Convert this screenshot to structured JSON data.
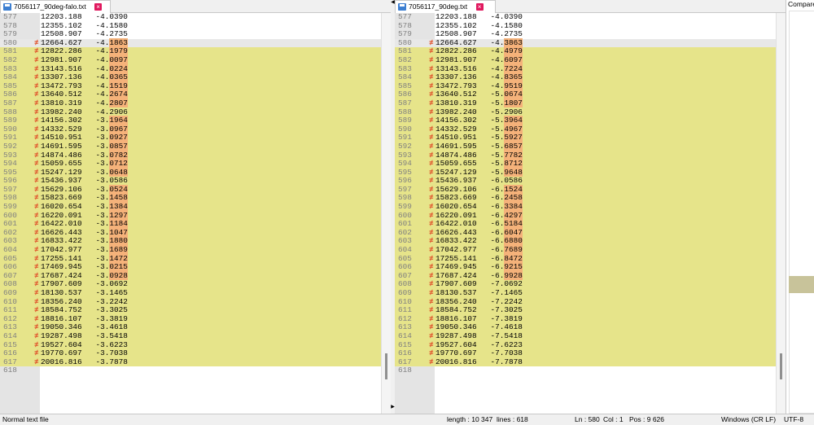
{
  "left": {
    "tab": "7056117_90deg-falo.txt",
    "rows": [
      {
        "n": "577",
        "x": "12203.188",
        "y": "-4.0390",
        "c": false,
        "h": ""
      },
      {
        "n": "578",
        "x": "12355.102",
        "y": "-4.1580",
        "c": false,
        "h": ""
      },
      {
        "n": "579",
        "x": "12508.907",
        "y": "-4.2735",
        "c": false,
        "h": ""
      },
      {
        "n": "580",
        "x": "12664.627",
        "y": "-4.1863",
        "c": true,
        "h": "1863"
      },
      {
        "n": "581",
        "x": "12822.286",
        "y": "-4.1979",
        "c": true,
        "h": "1979"
      },
      {
        "n": "582",
        "x": "12981.907",
        "y": "-4.0097",
        "c": true,
        "h": "0097"
      },
      {
        "n": "583",
        "x": "13143.516",
        "y": "-4.0224",
        "c": true,
        "h": "0224"
      },
      {
        "n": "584",
        "x": "13307.136",
        "y": "-4.0365",
        "c": true,
        "h": "0365"
      },
      {
        "n": "585",
        "x": "13472.793",
        "y": "-4.1519",
        "c": true,
        "h": "1519"
      },
      {
        "n": "586",
        "x": "13640.512",
        "y": "-4.2674",
        "c": true,
        "h": "2674"
      },
      {
        "n": "587",
        "x": "13810.319",
        "y": "-4.2807",
        "c": true,
        "h": "2807"
      },
      {
        "n": "588",
        "x": "13982.240",
        "y": "-4.2906",
        "c": true,
        "h": ""
      },
      {
        "n": "589",
        "x": "14156.302",
        "y": "-3.1964",
        "c": true,
        "h": "1964"
      },
      {
        "n": "590",
        "x": "14332.529",
        "y": "-3.0967",
        "c": true,
        "h": "0967"
      },
      {
        "n": "591",
        "x": "14510.951",
        "y": "-3.0927",
        "c": true,
        "h": "0927"
      },
      {
        "n": "592",
        "x": "14691.595",
        "y": "-3.0857",
        "c": true,
        "h": "0857"
      },
      {
        "n": "593",
        "x": "14874.486",
        "y": "-3.0782",
        "c": true,
        "h": "0782"
      },
      {
        "n": "594",
        "x": "15059.655",
        "y": "-3.0712",
        "c": true,
        "h": "0712"
      },
      {
        "n": "595",
        "x": "15247.129",
        "y": "-3.0648",
        "c": true,
        "h": "0648"
      },
      {
        "n": "596",
        "x": "15436.937",
        "y": "-3.0586",
        "c": true,
        "h": ""
      },
      {
        "n": "597",
        "x": "15629.106",
        "y": "-3.0524",
        "c": true,
        "h": "0524"
      },
      {
        "n": "598",
        "x": "15823.669",
        "y": "-3.1458",
        "c": true,
        "h": "1458"
      },
      {
        "n": "599",
        "x": "16020.654",
        "y": "-3.1384",
        "c": true,
        "h": "1384"
      },
      {
        "n": "600",
        "x": "16220.091",
        "y": "-3.1297",
        "c": true,
        "h": "1297"
      },
      {
        "n": "601",
        "x": "16422.010",
        "y": "-3.1184",
        "c": true,
        "h": "1184"
      },
      {
        "n": "602",
        "x": "16626.443",
        "y": "-3.1047",
        "c": true,
        "h": "1047"
      },
      {
        "n": "603",
        "x": "16833.422",
        "y": "-3.1880",
        "c": true,
        "h": "1880"
      },
      {
        "n": "604",
        "x": "17042.977",
        "y": "-3.1689",
        "c": true,
        "h": "1689"
      },
      {
        "n": "605",
        "x": "17255.141",
        "y": "-3.1472",
        "c": true,
        "h": "1472"
      },
      {
        "n": "606",
        "x": "17469.945",
        "y": "-3.0215",
        "c": true,
        "h": "0215"
      },
      {
        "n": "607",
        "x": "17687.424",
        "y": "-3.0928",
        "c": true,
        "h": "0928"
      },
      {
        "n": "608",
        "x": "17907.609",
        "y": "-3.0692",
        "c": true,
        "h": ""
      },
      {
        "n": "609",
        "x": "18130.537",
        "y": "-3.1465",
        "c": true,
        "h": ""
      },
      {
        "n": "610",
        "x": "18356.240",
        "y": "-3.2242",
        "c": true,
        "h": ""
      },
      {
        "n": "611",
        "x": "18584.752",
        "y": "-3.3025",
        "c": true,
        "h": ""
      },
      {
        "n": "612",
        "x": "18816.107",
        "y": "-3.3819",
        "c": true,
        "h": ""
      },
      {
        "n": "613",
        "x": "19050.346",
        "y": "-3.4618",
        "c": true,
        "h": ""
      },
      {
        "n": "614",
        "x": "19287.498",
        "y": "-3.5418",
        "c": true,
        "h": ""
      },
      {
        "n": "615",
        "x": "19527.604",
        "y": "-3.6223",
        "c": true,
        "h": ""
      },
      {
        "n": "616",
        "x": "19770.697",
        "y": "-3.7038",
        "c": true,
        "h": ""
      },
      {
        "n": "617",
        "x": "20016.816",
        "y": "-3.7878",
        "c": true,
        "h": ""
      },
      {
        "n": "618",
        "x": "",
        "y": "",
        "c": false,
        "h": ""
      }
    ]
  },
  "right": {
    "tab": "7056117_90deg.txt",
    "rows": [
      {
        "n": "577",
        "x": "12203.188",
        "y": "-4.0390",
        "c": false,
        "h": ""
      },
      {
        "n": "578",
        "x": "12355.102",
        "y": "-4.1580",
        "c": false,
        "h": ""
      },
      {
        "n": "579",
        "x": "12508.907",
        "y": "-4.2735",
        "c": false,
        "h": ""
      },
      {
        "n": "580",
        "x": "12664.627",
        "y": "-4.3863",
        "c": true,
        "h": "3863"
      },
      {
        "n": "581",
        "x": "12822.286",
        "y": "-4.4979",
        "c": true,
        "h": "4979"
      },
      {
        "n": "582",
        "x": "12981.907",
        "y": "-4.6097",
        "c": true,
        "h": "6097"
      },
      {
        "n": "583",
        "x": "13143.516",
        "y": "-4.7224",
        "c": true,
        "h": "7224"
      },
      {
        "n": "584",
        "x": "13307.136",
        "y": "-4.8365",
        "c": true,
        "h": "8365"
      },
      {
        "n": "585",
        "x": "13472.793",
        "y": "-4.9519",
        "c": true,
        "h": "9519"
      },
      {
        "n": "586",
        "x": "13640.512",
        "y": "-5.0674",
        "c": true,
        "h": "0674"
      },
      {
        "n": "587",
        "x": "13810.319",
        "y": "-5.1807",
        "c": true,
        "h": "1807"
      },
      {
        "n": "588",
        "x": "13982.240",
        "y": "-5.2906",
        "c": true,
        "h": ""
      },
      {
        "n": "589",
        "x": "14156.302",
        "y": "-5.3964",
        "c": true,
        "h": "3964"
      },
      {
        "n": "590",
        "x": "14332.529",
        "y": "-5.4967",
        "c": true,
        "h": "4967"
      },
      {
        "n": "591",
        "x": "14510.951",
        "y": "-5.5927",
        "c": true,
        "h": "5927"
      },
      {
        "n": "592",
        "x": "14691.595",
        "y": "-5.6857",
        "c": true,
        "h": "6857"
      },
      {
        "n": "593",
        "x": "14874.486",
        "y": "-5.7782",
        "c": true,
        "h": "7782"
      },
      {
        "n": "594",
        "x": "15059.655",
        "y": "-5.8712",
        "c": true,
        "h": "8712"
      },
      {
        "n": "595",
        "x": "15247.129",
        "y": "-5.9648",
        "c": true,
        "h": "9648"
      },
      {
        "n": "596",
        "x": "15436.937",
        "y": "-6.0586",
        "c": true,
        "h": ""
      },
      {
        "n": "597",
        "x": "15629.106",
        "y": "-6.1524",
        "c": true,
        "h": "1524"
      },
      {
        "n": "598",
        "x": "15823.669",
        "y": "-6.2458",
        "c": true,
        "h": "2458"
      },
      {
        "n": "599",
        "x": "16020.654",
        "y": "-6.3384",
        "c": true,
        "h": "3384"
      },
      {
        "n": "600",
        "x": "16220.091",
        "y": "-6.4297",
        "c": true,
        "h": "4297"
      },
      {
        "n": "601",
        "x": "16422.010",
        "y": "-6.5184",
        "c": true,
        "h": "5184"
      },
      {
        "n": "602",
        "x": "16626.443",
        "y": "-6.6047",
        "c": true,
        "h": "6047"
      },
      {
        "n": "603",
        "x": "16833.422",
        "y": "-6.6880",
        "c": true,
        "h": "6880"
      },
      {
        "n": "604",
        "x": "17042.977",
        "y": "-6.7689",
        "c": true,
        "h": "7689"
      },
      {
        "n": "605",
        "x": "17255.141",
        "y": "-6.8472",
        "c": true,
        "h": "8472"
      },
      {
        "n": "606",
        "x": "17469.945",
        "y": "-6.9215",
        "c": true,
        "h": "9215"
      },
      {
        "n": "607",
        "x": "17687.424",
        "y": "-6.9928",
        "c": true,
        "h": "9928"
      },
      {
        "n": "608",
        "x": "17907.609",
        "y": "-7.0692",
        "c": true,
        "h": ""
      },
      {
        "n": "609",
        "x": "18130.537",
        "y": "-7.1465",
        "c": true,
        "h": ""
      },
      {
        "n": "610",
        "x": "18356.240",
        "y": "-7.2242",
        "c": true,
        "h": ""
      },
      {
        "n": "611",
        "x": "18584.752",
        "y": "-7.3025",
        "c": true,
        "h": ""
      },
      {
        "n": "612",
        "x": "18816.107",
        "y": "-7.3819",
        "c": true,
        "h": ""
      },
      {
        "n": "613",
        "x": "19050.346",
        "y": "-7.4618",
        "c": true,
        "h": ""
      },
      {
        "n": "614",
        "x": "19287.498",
        "y": "-7.5418",
        "c": true,
        "h": ""
      },
      {
        "n": "615",
        "x": "19527.604",
        "y": "-7.6223",
        "c": true,
        "h": ""
      },
      {
        "n": "616",
        "x": "19770.697",
        "y": "-7.7038",
        "c": true,
        "h": ""
      },
      {
        "n": "617",
        "x": "20016.816",
        "y": "-7.7878",
        "c": true,
        "h": ""
      },
      {
        "n": "618",
        "x": "",
        "y": "",
        "c": false,
        "h": ""
      }
    ]
  },
  "compare_panel": {
    "title": "Compare"
  },
  "status": {
    "file_type": "Normal text file",
    "length": "length : 10 347",
    "lines": "lines : 618",
    "ln": "Ln : 580",
    "col": "Col : 1",
    "pos": "Pos : 9 626",
    "eol": "Windows (CR LF)",
    "encoding": "UTF-8"
  },
  "colors": {
    "changed_line": "#e6e48a",
    "char_diff": "#f5b27a",
    "marker": "#e0502a"
  },
  "icons": {
    "tab_save": "save-icon",
    "tab_close": "close-icon",
    "diff_marker": "changed-line-marker"
  },
  "current_line": "580"
}
